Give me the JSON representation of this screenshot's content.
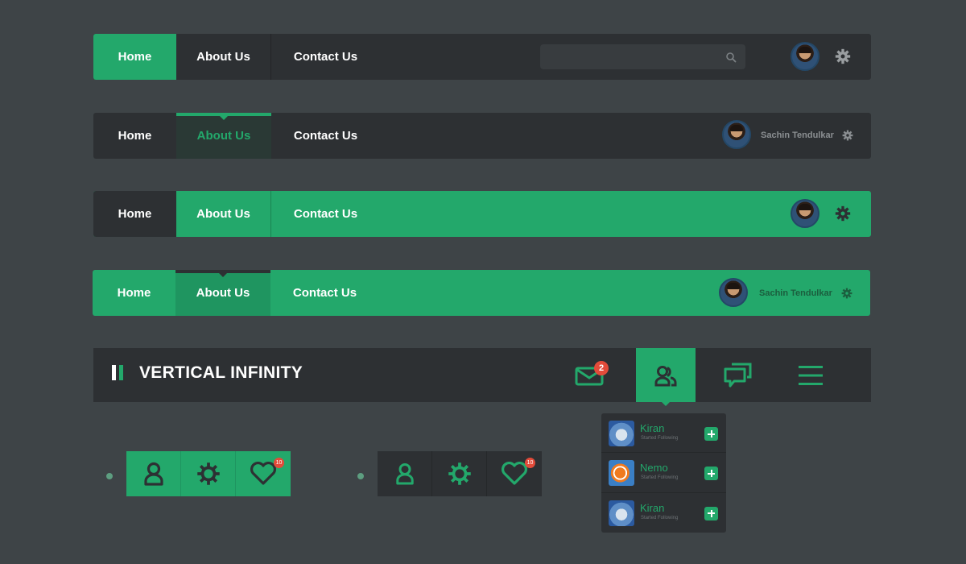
{
  "nav": {
    "home": "Home",
    "about": "About Us",
    "contact": "Contact Us"
  },
  "user": {
    "name": "Sachin Tendulkar"
  },
  "header": {
    "brand": "VERTICAL INFINITY",
    "messages_badge": "2",
    "buttons": [
      "envelope-icon",
      "users-icon",
      "chat-icon",
      "menu-icon"
    ]
  },
  "notifications": [
    {
      "name": "Kiran",
      "status": "Started Following"
    },
    {
      "name": "Nemo",
      "status": "Started Following"
    },
    {
      "name": "Kiran",
      "status": "Started Following"
    }
  ],
  "toolbar": {
    "heart_badge": "10"
  },
  "colors": {
    "accent": "#23a86b",
    "dark": "#2d3033",
    "background": "#3e4447",
    "badge": "#e34b3a"
  }
}
